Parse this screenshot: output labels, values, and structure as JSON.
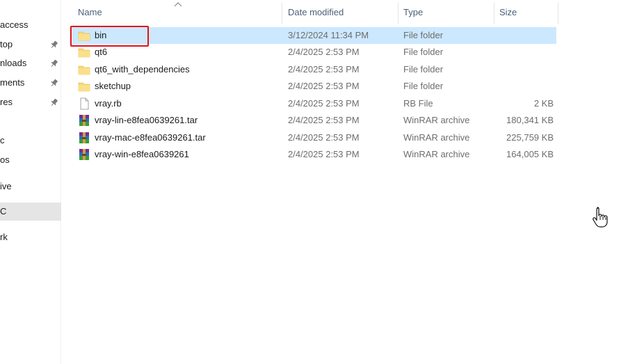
{
  "nav": {
    "items": [
      {
        "label": "access",
        "pinned": false
      },
      {
        "label": "top",
        "pinned": true
      },
      {
        "label": "nloads",
        "pinned": true
      },
      {
        "label": "ments",
        "pinned": true
      },
      {
        "label": "res",
        "pinned": true
      },
      {
        "label": "c",
        "pinned": false
      },
      {
        "label": "os",
        "pinned": false
      },
      {
        "label": "ive",
        "pinned": false
      },
      {
        "label": "C",
        "pinned": false
      },
      {
        "label": "rk",
        "pinned": false
      }
    ]
  },
  "columns": {
    "name": "Name",
    "date": "Date modified",
    "type": "Type",
    "size": "Size"
  },
  "files": [
    {
      "name": "bin",
      "date": "3/12/2024 11:34 PM",
      "type": "File folder",
      "size": "",
      "icon": "folder-icon"
    },
    {
      "name": "qt6",
      "date": "2/4/2025 2:53 PM",
      "type": "File folder",
      "size": "",
      "icon": "folder-icon"
    },
    {
      "name": "qt6_with_dependencies",
      "date": "2/4/2025 2:53 PM",
      "type": "File folder",
      "size": "",
      "icon": "folder-icon"
    },
    {
      "name": "sketchup",
      "date": "2/4/2025 2:53 PM",
      "type": "File folder",
      "size": "",
      "icon": "folder-icon"
    },
    {
      "name": "vray.rb",
      "date": "2/4/2025 2:53 PM",
      "type": "RB File",
      "size": "2 KB",
      "icon": "file-icon"
    },
    {
      "name": "vray-lin-e8fea0639261.tar",
      "date": "2/4/2025 2:53 PM",
      "type": "WinRAR archive",
      "size": "180,341 KB",
      "icon": "winrar-icon"
    },
    {
      "name": "vray-mac-e8fea0639261.tar",
      "date": "2/4/2025 2:53 PM",
      "type": "WinRAR archive",
      "size": "225,759 KB",
      "icon": "winrar-icon"
    },
    {
      "name": "vray-win-e8fea0639261",
      "date": "2/4/2025 2:53 PM",
      "type": "WinRAR archive",
      "size": "164,005 KB",
      "icon": "winrar-icon"
    }
  ],
  "colors": {
    "selection": "#cce8ff",
    "highlight_box": "#e0101a",
    "folder": "#f8d775"
  }
}
